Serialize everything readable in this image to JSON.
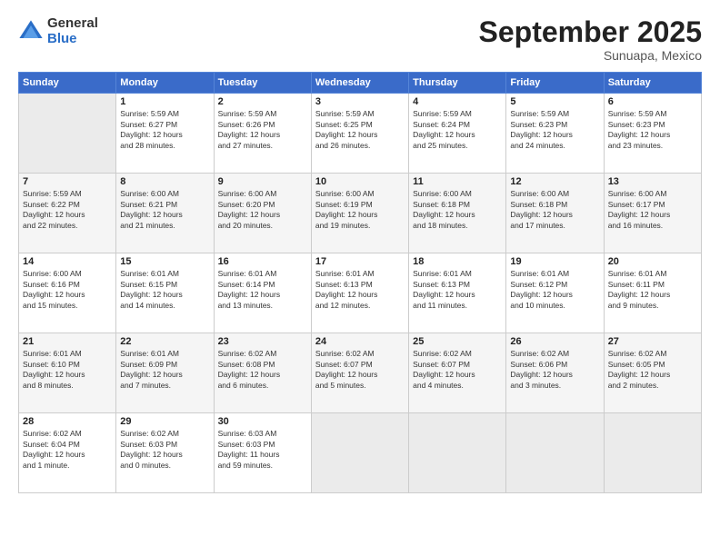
{
  "header": {
    "logo_general": "General",
    "logo_blue": "Blue",
    "month_title": "September 2025",
    "subtitle": "Sunuapa, Mexico"
  },
  "weekdays": [
    "Sunday",
    "Monday",
    "Tuesday",
    "Wednesday",
    "Thursday",
    "Friday",
    "Saturday"
  ],
  "weeks": [
    [
      {
        "day": "",
        "info": ""
      },
      {
        "day": "1",
        "info": "Sunrise: 5:59 AM\nSunset: 6:27 PM\nDaylight: 12 hours\nand 28 minutes."
      },
      {
        "day": "2",
        "info": "Sunrise: 5:59 AM\nSunset: 6:26 PM\nDaylight: 12 hours\nand 27 minutes."
      },
      {
        "day": "3",
        "info": "Sunrise: 5:59 AM\nSunset: 6:25 PM\nDaylight: 12 hours\nand 26 minutes."
      },
      {
        "day": "4",
        "info": "Sunrise: 5:59 AM\nSunset: 6:24 PM\nDaylight: 12 hours\nand 25 minutes."
      },
      {
        "day": "5",
        "info": "Sunrise: 5:59 AM\nSunset: 6:23 PM\nDaylight: 12 hours\nand 24 minutes."
      },
      {
        "day": "6",
        "info": "Sunrise: 5:59 AM\nSunset: 6:23 PM\nDaylight: 12 hours\nand 23 minutes."
      }
    ],
    [
      {
        "day": "7",
        "info": "Sunrise: 5:59 AM\nSunset: 6:22 PM\nDaylight: 12 hours\nand 22 minutes."
      },
      {
        "day": "8",
        "info": "Sunrise: 6:00 AM\nSunset: 6:21 PM\nDaylight: 12 hours\nand 21 minutes."
      },
      {
        "day": "9",
        "info": "Sunrise: 6:00 AM\nSunset: 6:20 PM\nDaylight: 12 hours\nand 20 minutes."
      },
      {
        "day": "10",
        "info": "Sunrise: 6:00 AM\nSunset: 6:19 PM\nDaylight: 12 hours\nand 19 minutes."
      },
      {
        "day": "11",
        "info": "Sunrise: 6:00 AM\nSunset: 6:18 PM\nDaylight: 12 hours\nand 18 minutes."
      },
      {
        "day": "12",
        "info": "Sunrise: 6:00 AM\nSunset: 6:18 PM\nDaylight: 12 hours\nand 17 minutes."
      },
      {
        "day": "13",
        "info": "Sunrise: 6:00 AM\nSunset: 6:17 PM\nDaylight: 12 hours\nand 16 minutes."
      }
    ],
    [
      {
        "day": "14",
        "info": "Sunrise: 6:00 AM\nSunset: 6:16 PM\nDaylight: 12 hours\nand 15 minutes."
      },
      {
        "day": "15",
        "info": "Sunrise: 6:01 AM\nSunset: 6:15 PM\nDaylight: 12 hours\nand 14 minutes."
      },
      {
        "day": "16",
        "info": "Sunrise: 6:01 AM\nSunset: 6:14 PM\nDaylight: 12 hours\nand 13 minutes."
      },
      {
        "day": "17",
        "info": "Sunrise: 6:01 AM\nSunset: 6:13 PM\nDaylight: 12 hours\nand 12 minutes."
      },
      {
        "day": "18",
        "info": "Sunrise: 6:01 AM\nSunset: 6:13 PM\nDaylight: 12 hours\nand 11 minutes."
      },
      {
        "day": "19",
        "info": "Sunrise: 6:01 AM\nSunset: 6:12 PM\nDaylight: 12 hours\nand 10 minutes."
      },
      {
        "day": "20",
        "info": "Sunrise: 6:01 AM\nSunset: 6:11 PM\nDaylight: 12 hours\nand 9 minutes."
      }
    ],
    [
      {
        "day": "21",
        "info": "Sunrise: 6:01 AM\nSunset: 6:10 PM\nDaylight: 12 hours\nand 8 minutes."
      },
      {
        "day": "22",
        "info": "Sunrise: 6:01 AM\nSunset: 6:09 PM\nDaylight: 12 hours\nand 7 minutes."
      },
      {
        "day": "23",
        "info": "Sunrise: 6:02 AM\nSunset: 6:08 PM\nDaylight: 12 hours\nand 6 minutes."
      },
      {
        "day": "24",
        "info": "Sunrise: 6:02 AM\nSunset: 6:07 PM\nDaylight: 12 hours\nand 5 minutes."
      },
      {
        "day": "25",
        "info": "Sunrise: 6:02 AM\nSunset: 6:07 PM\nDaylight: 12 hours\nand 4 minutes."
      },
      {
        "day": "26",
        "info": "Sunrise: 6:02 AM\nSunset: 6:06 PM\nDaylight: 12 hours\nand 3 minutes."
      },
      {
        "day": "27",
        "info": "Sunrise: 6:02 AM\nSunset: 6:05 PM\nDaylight: 12 hours\nand 2 minutes."
      }
    ],
    [
      {
        "day": "28",
        "info": "Sunrise: 6:02 AM\nSunset: 6:04 PM\nDaylight: 12 hours\nand 1 minute."
      },
      {
        "day": "29",
        "info": "Sunrise: 6:02 AM\nSunset: 6:03 PM\nDaylight: 12 hours\nand 0 minutes."
      },
      {
        "day": "30",
        "info": "Sunrise: 6:03 AM\nSunset: 6:03 PM\nDaylight: 11 hours\nand 59 minutes."
      },
      {
        "day": "",
        "info": ""
      },
      {
        "day": "",
        "info": ""
      },
      {
        "day": "",
        "info": ""
      },
      {
        "day": "",
        "info": ""
      }
    ]
  ]
}
